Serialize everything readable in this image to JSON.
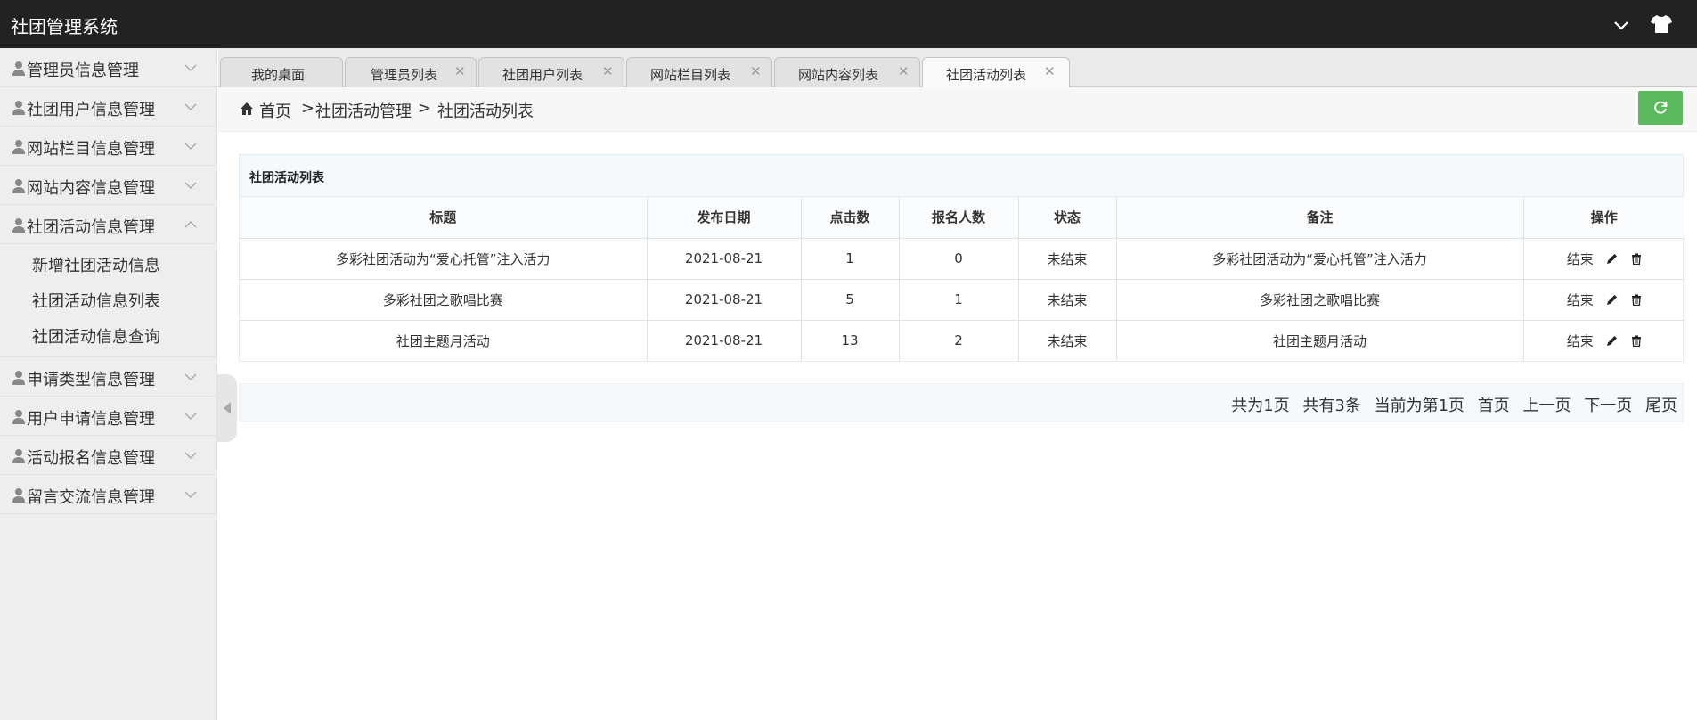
{
  "header": {
    "title": "社团管理系统",
    "icons": [
      "chevron-down-icon",
      "tshirt-icon"
    ]
  },
  "sidebar": {
    "items": [
      {
        "label": "管理员信息管理",
        "expanded": false
      },
      {
        "label": "社团用户信息管理",
        "expanded": false
      },
      {
        "label": "网站栏目信息管理",
        "expanded": false
      },
      {
        "label": "网站内容信息管理",
        "expanded": false
      },
      {
        "label": "社团活动信息管理",
        "expanded": true
      },
      {
        "label": "申请类型信息管理",
        "expanded": false
      },
      {
        "label": "用户申请信息管理",
        "expanded": false
      },
      {
        "label": "活动报名信息管理",
        "expanded": false
      },
      {
        "label": "留言交流信息管理",
        "expanded": false
      }
    ],
    "submenu": [
      "新增社团活动信息",
      "社团活动信息列表",
      "社团活动信息查询"
    ]
  },
  "tabs": [
    {
      "label": "我的桌面",
      "closable": false
    },
    {
      "label": "管理员列表",
      "closable": true
    },
    {
      "label": "社团用户列表",
      "closable": true
    },
    {
      "label": "网站栏目列表",
      "closable": true
    },
    {
      "label": "网站内容列表",
      "closable": true
    },
    {
      "label": "社团活动列表",
      "closable": true,
      "active": true
    }
  ],
  "breadcrumb": {
    "home": "首页",
    "sep": ">",
    "level1": "社团活动管理",
    "level2": "社团活动列表"
  },
  "panel": {
    "title": "社团活动列表",
    "columns": [
      "标题",
      "发布日期",
      "点击数",
      "报名人数",
      "状态",
      "备注",
      "操作"
    ],
    "rows": [
      {
        "title": "多彩社团活动为“爱心托管”注入活力",
        "date": "2021-08-21",
        "clicks": "1",
        "signups": "0",
        "status": "未结束",
        "remark": "多彩社团活动为“爱心托管”注入活力",
        "action": "结束"
      },
      {
        "title": "多彩社团之歌唱比赛",
        "date": "2021-08-21",
        "clicks": "5",
        "signups": "1",
        "status": "未结束",
        "remark": "多彩社团之歌唱比赛",
        "action": "结束"
      },
      {
        "title": "社团主题月活动",
        "date": "2021-08-21",
        "clicks": "13",
        "signups": "2",
        "status": "未结束",
        "remark": "社团主题月活动",
        "action": "结束"
      }
    ]
  },
  "pager": {
    "total_pages": "共为1页",
    "total_items": "共有3条",
    "current": "当前为第1页",
    "first": "首页",
    "prev": "上一页",
    "next": "下一页",
    "last": "尾页"
  },
  "colors": {
    "header_bg": "#222222",
    "sidebar_bg": "#eeeeee",
    "refresh_green": "#5cb85c"
  }
}
